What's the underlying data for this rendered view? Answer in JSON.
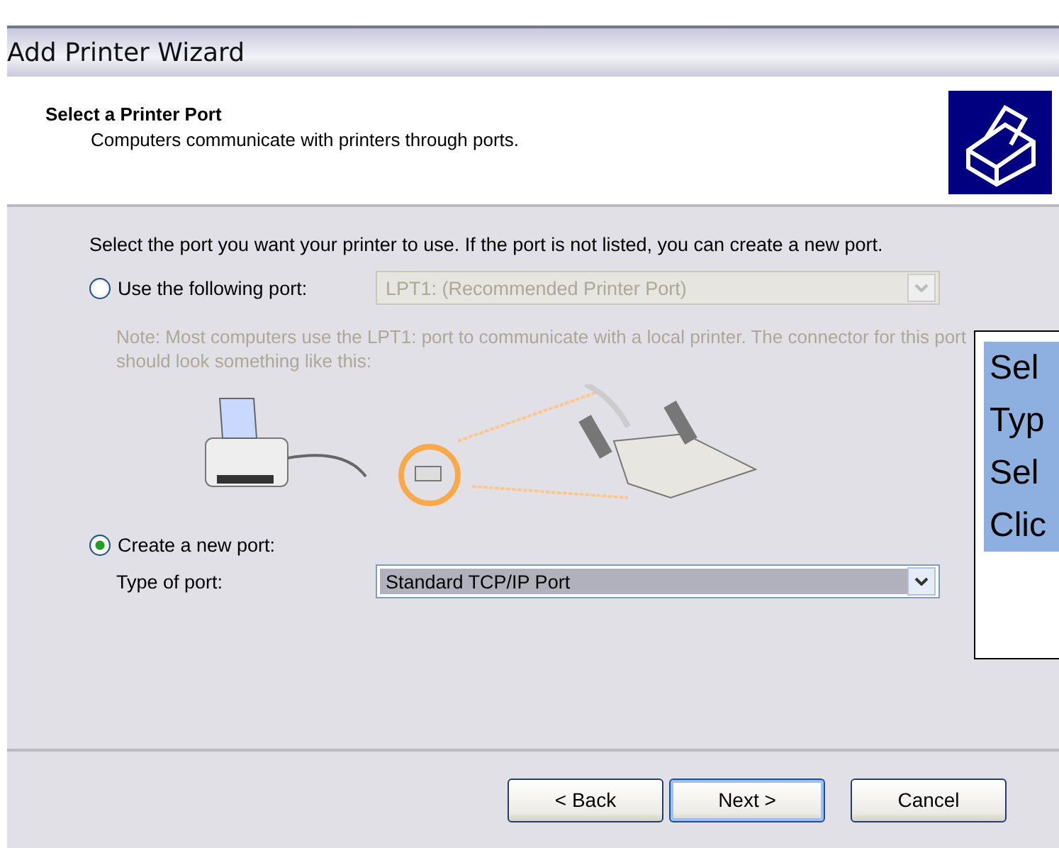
{
  "window": {
    "title": "Add Printer Wizard"
  },
  "header": {
    "title": "Select a Printer Port",
    "subtitle": "Computers communicate with printers through ports."
  },
  "intro": "Select the port you want your printer to use.  If the port is not listed, you can create a new port.",
  "options": [
    {
      "label": "Use the following port:",
      "selected": false,
      "value": "LPT1: (Recommended Printer Port)",
      "disabled": true
    },
    {
      "label": "Create a new port:",
      "selected": true
    }
  ],
  "note": "Note: Most computers use the LPT1: port to communicate with a local printer. The connector for this port should look something like this:",
  "port_type": {
    "label": "Type of port:",
    "value": "Standard TCP/IP Port",
    "disabled": false
  },
  "buttons": [
    {
      "label": "< Back",
      "default": false
    },
    {
      "label": "Next >",
      "default": true
    },
    {
      "label": "Cancel",
      "default": false
    }
  ],
  "callout": [
    "Sel",
    "Typ",
    "Sel",
    "Clic"
  ]
}
